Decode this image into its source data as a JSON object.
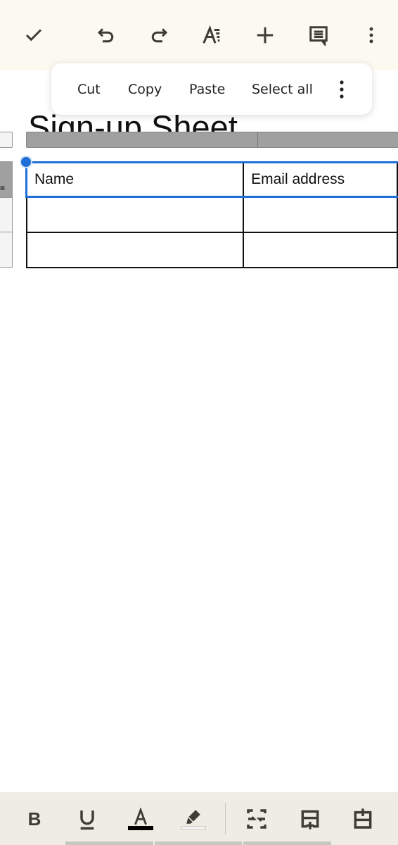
{
  "toolbar": {
    "icons": [
      "check-icon",
      "undo-icon",
      "redo-icon",
      "text-format-icon",
      "insert-icon",
      "comment-icon",
      "more-vert-icon"
    ]
  },
  "context_menu": {
    "items": [
      "Cut",
      "Copy",
      "Paste",
      "Select all"
    ],
    "more": "more-vert-icon"
  },
  "document": {
    "title": "Sign-up Sheet",
    "table": {
      "rows": [
        [
          "Name",
          "Email address"
        ],
        [
          "",
          ""
        ],
        [
          "",
          ""
        ]
      ]
    }
  },
  "format_bar": {
    "icons": [
      "bold-icon",
      "underline-icon",
      "text-color-icon",
      "highlight-icon",
      "merge-cells-icon",
      "insert-row-below-icon",
      "insert-row-above-icon"
    ],
    "text_color": "#000000",
    "accent": "#1f6fd6"
  }
}
